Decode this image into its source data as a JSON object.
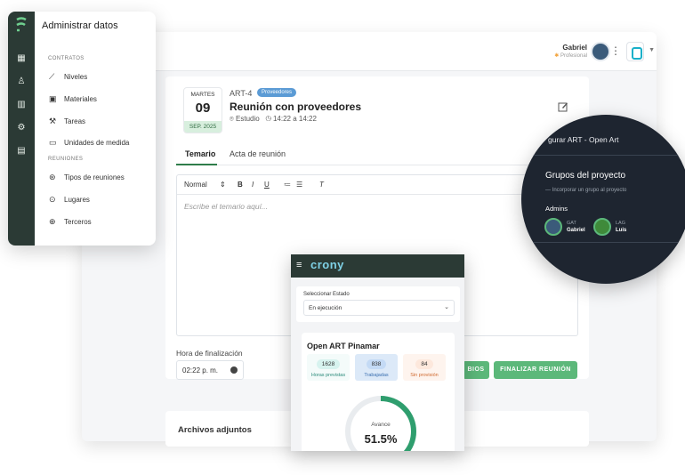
{
  "header": {
    "user_name": "Gabriel",
    "user_role": "Profesional",
    "role_star": "✱"
  },
  "meeting": {
    "day_name": "MARTES",
    "day_number": "09",
    "month_year": "SEP. 2025",
    "code": "ART-4",
    "tag": "Proveedores",
    "title": "Reunión con proveedores",
    "location": "Estudio",
    "time_range": "14:22 a 14:22"
  },
  "tabs": [
    {
      "label": "Temario",
      "active": true
    },
    {
      "label": "Acta de reunión",
      "active": false
    }
  ],
  "editor": {
    "format": "Normal",
    "bold": "B",
    "italic": "I",
    "underline": "U",
    "clear": "T",
    "placeholder": "Escribe el temario aquí..."
  },
  "end_time": {
    "label": "Hora de finalización",
    "value": "02:22 p. m."
  },
  "buttons": {
    "save_changes_partial": "BIOS",
    "finish_meeting": "FINALIZAR REUNIÓN"
  },
  "attachments": {
    "title": "Archivos adjuntos"
  },
  "sidebar": {
    "title": "Administrar datos",
    "sections": [
      {
        "label": "CONTRATOS",
        "items": [
          {
            "label": "Niveles",
            "icon": "stairs-icon"
          },
          {
            "label": "Materiales",
            "icon": "material-icon"
          },
          {
            "label": "Tareas",
            "icon": "tools-icon"
          },
          {
            "label": "Unidades de medida",
            "icon": "ruler-icon"
          }
        ]
      },
      {
        "label": "REUNIONES",
        "items": [
          {
            "label": "Tipos de reuniones",
            "icon": "meeting-types-icon"
          },
          {
            "label": "Lugares",
            "icon": "location-icon"
          },
          {
            "label": "Terceros",
            "icon": "third-party-icon"
          }
        ]
      }
    ]
  },
  "project_popup": {
    "header": "gurar ART - Open Art",
    "title": "Grupos del proyecto",
    "add_group": "Incorporar un grupo al proyecto",
    "admins_label": "Admins",
    "members": [
      {
        "code": "GAT",
        "name": "Gabriel"
      },
      {
        "code": "LAG",
        "name": "Luis"
      }
    ]
  },
  "mobile": {
    "logo": "crony",
    "state_label": "Seleccionar Estado",
    "state_value": "En ejecución",
    "project_title": "Open ART Pinamar",
    "stats": [
      {
        "value": "1628",
        "label": "Horas previstas",
        "color": "#d7f3ef",
        "text_color": "#2b8a7a"
      },
      {
        "value": "838",
        "label": "Trabajadas",
        "color": "#dce9f8",
        "text_color": "#3a6fb0"
      },
      {
        "value": "84",
        "label": "Sin provisión",
        "color": "#fde8dc",
        "text_color": "#d06a30"
      }
    ],
    "gauge_label": "Avance",
    "gauge_value": "51.5%",
    "gauge_fraction": 0.515
  },
  "colors": {
    "accent_green": "#5cb87a",
    "sidebar_dark": "#2b3a35",
    "popup_dark": "#1e2530"
  }
}
